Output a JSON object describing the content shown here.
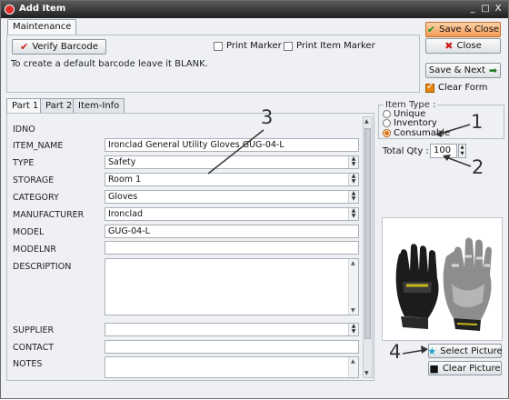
{
  "window": {
    "title": "Add Item",
    "controls": [
      "_",
      "□",
      "X"
    ]
  },
  "top_tab": "Maintenance",
  "maintenance": {
    "verify_label": "Verify Barcode",
    "print_marker": "Print Marker",
    "print_item_marker": "Print Item Marker",
    "hint": "To create a default barcode leave it BLANK."
  },
  "actions": {
    "save_close": "Save & Close",
    "close": "Close",
    "save_next": "Save & Next",
    "clear_form": "Clear Form",
    "clear_form_checked": true
  },
  "tabs": [
    "Part 1",
    "Part 2",
    "Item-Info"
  ],
  "fields": {
    "idno": {
      "label": "IDNO",
      "value": ""
    },
    "item_name": {
      "label": "ITEM_NAME",
      "value": "Ironclad General Utility Gloves GUG-04-L"
    },
    "type": {
      "label": "TYPE",
      "value": "Safety"
    },
    "storage": {
      "label": "STORAGE",
      "value": "Room 1"
    },
    "category": {
      "label": "CATEGORY",
      "value": "Gloves"
    },
    "manufacturer": {
      "label": "MANUFACTURER",
      "value": "Ironclad"
    },
    "model": {
      "label": "MODEL",
      "value": "GUG-04-L"
    },
    "modelnr": {
      "label": "MODELNR",
      "value": ""
    },
    "description": {
      "label": "DESCRIPTION",
      "value": ""
    },
    "supplier": {
      "label": "SUPPLIER",
      "value": ""
    },
    "contact": {
      "label": "CONTACT",
      "value": ""
    },
    "notes": {
      "label": "NOTES",
      "value": ""
    }
  },
  "item_type": {
    "legend": "Item Type :",
    "options": [
      "Unique",
      "Inventory",
      "Consumable"
    ],
    "selected": "Consumable"
  },
  "total_qty": {
    "label": "Total Qty :",
    "value": "100"
  },
  "picture": {
    "select_label": "Select Picture",
    "clear_label": "Clear Picture"
  },
  "annotations": [
    "1",
    "2",
    "3",
    "4"
  ],
  "colors": {
    "accent": "#f39a55",
    "radio_on": "#e8700c",
    "red": "#d01818",
    "green": "#1f9a1f"
  }
}
